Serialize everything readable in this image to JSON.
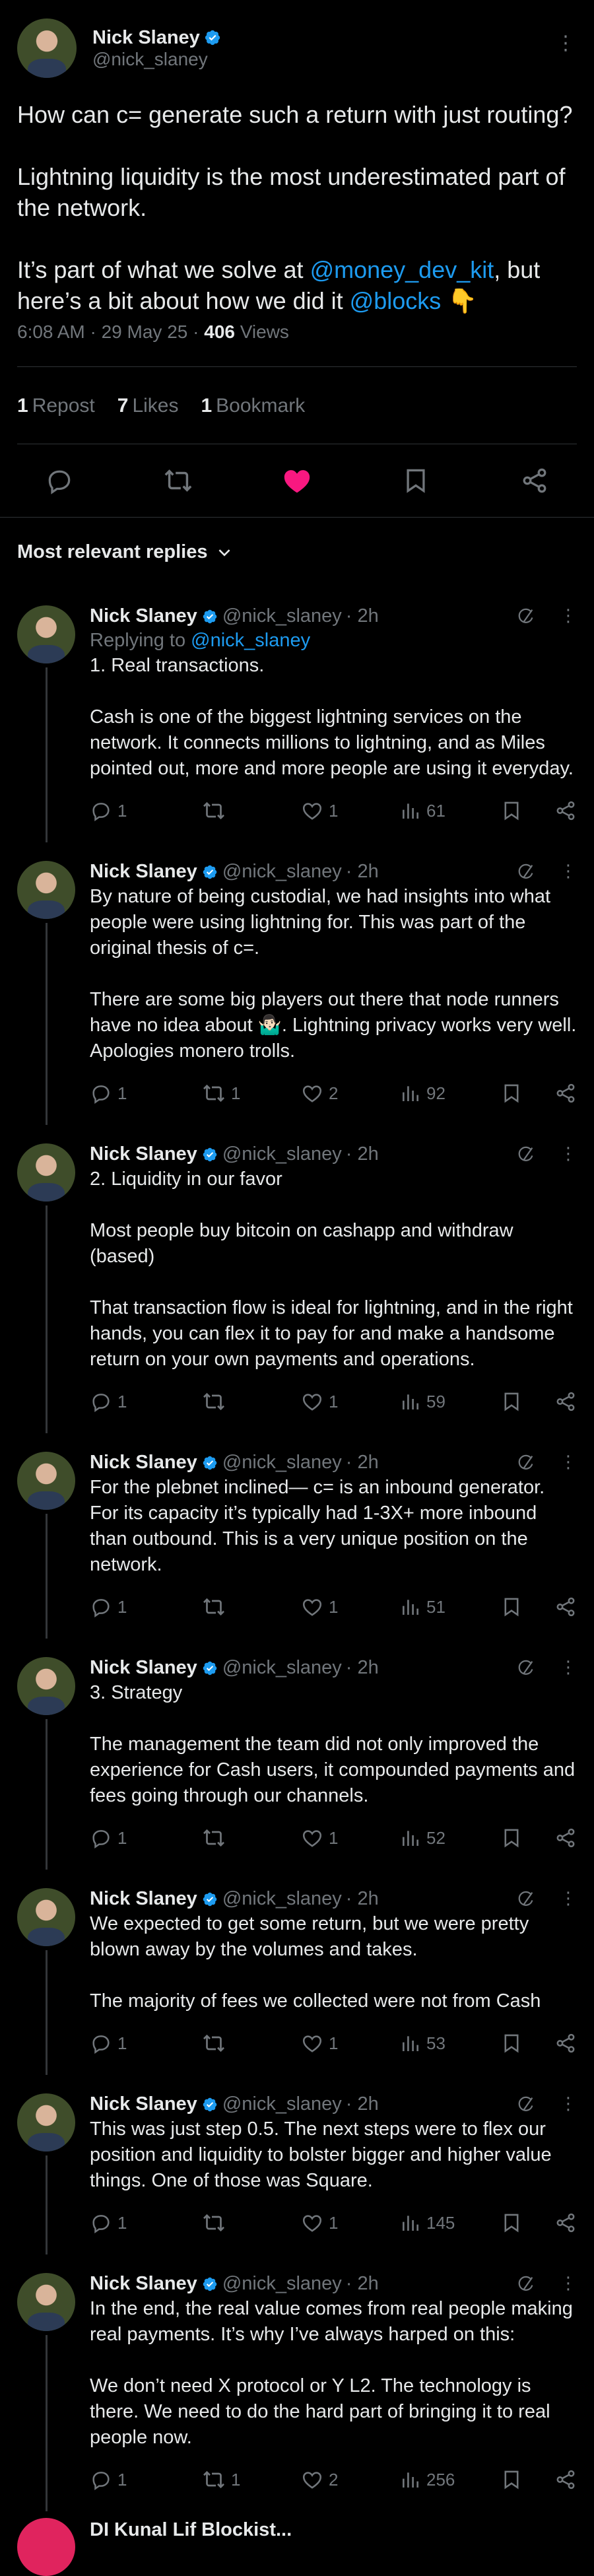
{
  "main": {
    "author_name": "Nick Slaney",
    "author_handle": "@nick_slaney",
    "text_a": "How can c= generate such a return with just routing?\n\nLightning liquidity is the most underestimated part of the network.\n\nIt’s part of what we solve at ",
    "mention_1": "@money_dev_kit",
    "text_b": ", but here’s a bit about how we did it ",
    "mention_2": "@blocks",
    "text_c": " 👇",
    "time": "6:08 AM · 29 May 25 · ",
    "views_count": "406",
    "views_label": " Views",
    "reposts_count": "1",
    "reposts_label": "Repost",
    "likes_count": "7",
    "likes_label": "Likes",
    "bookmarks_count": "1",
    "bookmarks_label": "Bookmark"
  },
  "replies_header": "Most relevant replies",
  "replies": [
    {
      "name": "Nick Slaney",
      "handle": "@nick_slaney",
      "time": "· 2h",
      "replying_prefix": "Replying to ",
      "replying_to": "@nick_slaney",
      "text": "1. Real transactions.\n\nCash is one of the biggest lightning services on the network. It connects millions to lightning, and as Miles pointed out, more and more people are using it everyday.",
      "replies": "1",
      "reposts": "",
      "likes": "1",
      "views": "61"
    },
    {
      "name": "Nick Slaney",
      "handle": "@nick_slaney",
      "time": "· 2h",
      "text": "By nature of being custodial, we had insights into what people were using lightning for. This was part of the original thesis of c=.\n\nThere are some big players out there that node runners have no idea about 🤷🏻‍♂️. Lightning privacy works very well. Apologies monero trolls.",
      "replies": "1",
      "reposts": "1",
      "likes": "2",
      "views": "92"
    },
    {
      "name": "Nick Slaney",
      "handle": "@nick_slaney",
      "time": "· 2h",
      "text": "2. Liquidity in our favor\n\nMost people buy bitcoin on cashapp and withdraw (based)\n\nThat transaction flow is ideal for lightning, and in the right hands, you can flex it to pay for and make a handsome return on your own payments and operations.",
      "replies": "1",
      "reposts": "",
      "likes": "1",
      "views": "59"
    },
    {
      "name": "Nick Slaney",
      "handle": "@nick_slaney",
      "time": "· 2h",
      "text": "For the plebnet inclined— c= is an inbound generator. For its capacity it’s typically had 1-3X+ more inbound than outbound. This is a very unique position on the network.",
      "replies": "1",
      "reposts": "",
      "likes": "1",
      "views": "51"
    },
    {
      "name": "Nick Slaney",
      "handle": "@nick_slaney",
      "time": "· 2h",
      "text": "3. Strategy\n\nThe management the team did not only improved the experience for Cash users, it compounded payments and fees going through our channels.",
      "replies": "1",
      "reposts": "",
      "likes": "1",
      "views": "52"
    },
    {
      "name": "Nick Slaney",
      "handle": "@nick_slaney",
      "time": "· 2h",
      "text": "We expected to get some return, but we were pretty blown away by the volumes and takes.\n\nThe majority of fees we collected were not from Cash",
      "replies": "1",
      "reposts": "",
      "likes": "1",
      "views": "53"
    },
    {
      "name": "Nick Slaney",
      "handle": "@nick_slaney",
      "time": "· 2h",
      "text": "This was just step 0.5. The next steps were to flex our position and liquidity to bolster bigger and higher value things. One of those was Square.",
      "replies": "1",
      "reposts": "",
      "likes": "1",
      "views": "145"
    },
    {
      "name": "Nick Slaney",
      "handle": "@nick_slaney",
      "time": "· 2h",
      "text": "In the end, the real value comes from real people making real payments. It’s why I’ve always harped on this:\n\nWe don’t need X protocol or Y L2. The technology is there. We need to do the hard part of bringing it to real people now.",
      "replies": "1",
      "reposts": "1",
      "likes": "2",
      "views": "256"
    }
  ],
  "next_reply_name": "DI Kunal Lif Blockist...",
  "colors": {
    "accent": "#1d9bf0",
    "like": "#f91880",
    "muted": "#71767b",
    "text": "#e7e9ea",
    "border": "#2f3336"
  },
  "icons": [
    "verified-badge-icon",
    "more-icon",
    "reply-icon",
    "repost-icon",
    "like-filled-icon",
    "like-icon",
    "bookmark-icon",
    "share-icon",
    "views-icon",
    "grok-icon",
    "chevron-down-icon"
  ]
}
